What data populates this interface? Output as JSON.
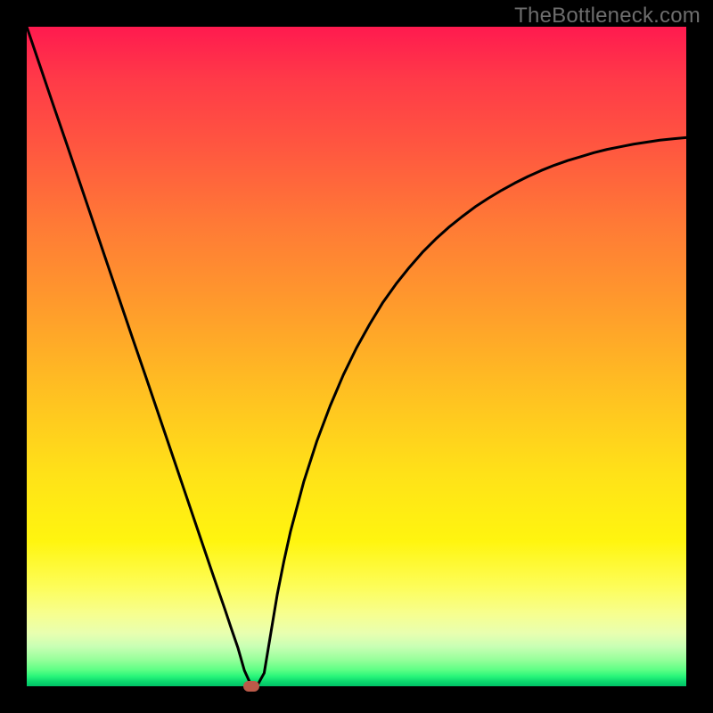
{
  "watermark": "TheBottleneck.com",
  "colors": {
    "curve_stroke": "#000000",
    "marker_fill": "#bb5a49",
    "frame_bg": "#000000"
  },
  "chart_data": {
    "type": "line",
    "title": "",
    "xlabel": "",
    "ylabel": "",
    "xlim": [
      0,
      100
    ],
    "ylim": [
      0,
      100
    ],
    "grid": false,
    "minimum_marker": {
      "x": 34,
      "y": 0
    },
    "series": [
      {
        "name": "bottleneck-curve",
        "x": [
          0,
          2,
          4,
          6,
          8,
          10,
          12,
          14,
          16,
          18,
          20,
          22,
          24,
          26,
          28,
          29,
          30,
          31,
          32,
          33,
          34,
          35,
          36,
          37,
          38,
          39,
          40,
          42,
          44,
          46,
          48,
          50,
          52,
          54,
          56,
          58,
          60,
          62,
          64,
          66,
          68,
          70,
          72,
          74,
          76,
          78,
          80,
          82,
          84,
          86,
          88,
          90,
          92,
          94,
          96,
          98,
          100
        ],
        "y": [
          100,
          94.1,
          88.2,
          82.4,
          76.5,
          70.6,
          64.7,
          58.8,
          52.9,
          47.1,
          41.2,
          35.3,
          29.4,
          23.5,
          17.6,
          14.7,
          11.8,
          8.8,
          5.9,
          2.4,
          0.2,
          0.2,
          2.0,
          8.0,
          14.0,
          19.0,
          23.5,
          31.0,
          37.2,
          42.5,
          47.2,
          51.3,
          54.9,
          58.2,
          61.0,
          63.5,
          65.8,
          67.8,
          69.6,
          71.2,
          72.7,
          74.0,
          75.2,
          76.3,
          77.3,
          78.2,
          79.0,
          79.7,
          80.3,
          80.9,
          81.4,
          81.8,
          82.2,
          82.5,
          82.8,
          83.0,
          83.2
        ]
      }
    ],
    "background_gradient": [
      {
        "pos": 0,
        "color": "#ff1a4f"
      },
      {
        "pos": 0.5,
        "color": "#ffd21a"
      },
      {
        "pos": 0.9,
        "color": "#f0ffa0"
      },
      {
        "pos": 1.0,
        "color": "#00c267"
      }
    ]
  }
}
